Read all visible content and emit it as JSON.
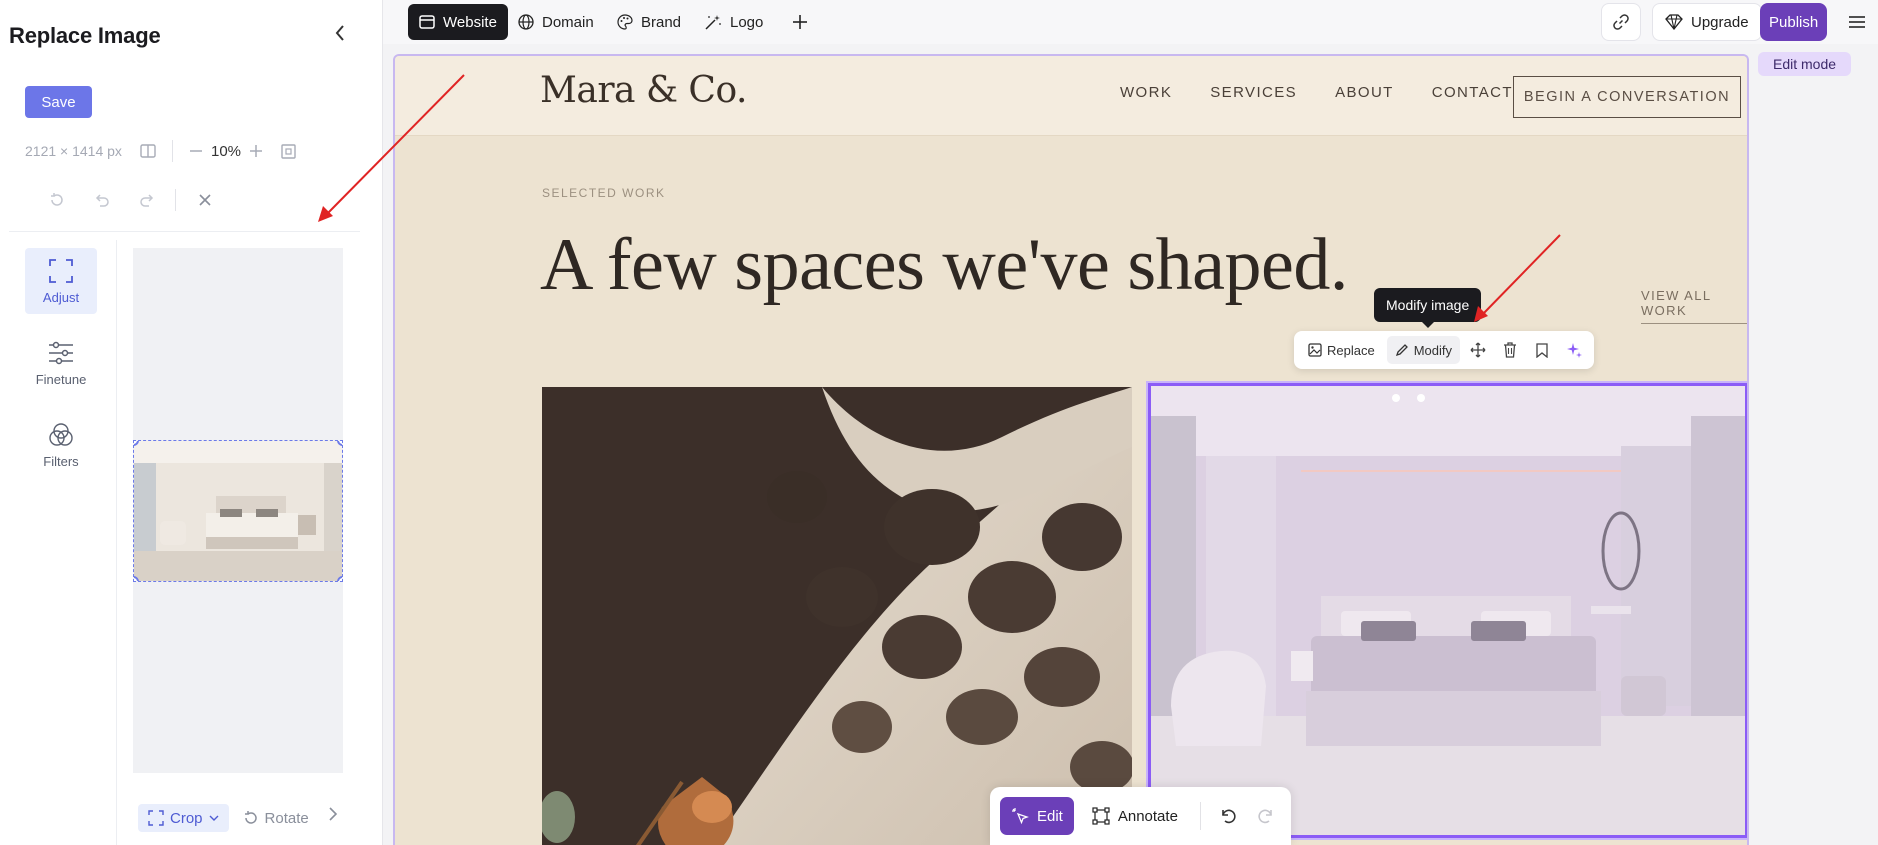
{
  "panel": {
    "title": "Replace Image",
    "save_label": "Save",
    "dimensions": "2121 × 1414 px",
    "zoom": "10%",
    "tools": [
      {
        "label": "Adjust"
      },
      {
        "label": "Finetune"
      },
      {
        "label": "Filters"
      }
    ],
    "crop_label": "Crop",
    "rotate_label": "Rotate"
  },
  "topbar": {
    "tabs": [
      "Website",
      "Domain",
      "Brand",
      "Logo"
    ],
    "upgrade_label": "Upgrade",
    "publish_label": "Publish"
  },
  "edit_mode_label": "Edit mode",
  "site": {
    "logo": "Mara & Co.",
    "nav": [
      "WORK",
      "SERVICES",
      "ABOUT",
      "CONTACT"
    ],
    "cta": "BEGIN A CONVERSATION",
    "eyebrow": "SELECTED WORK",
    "headline": "A few spaces we've shaped.",
    "view_all": "VIEW ALL WORK"
  },
  "image_toolbar": {
    "replace_label": "Replace",
    "modify_label": "Modify",
    "tooltip": "Modify image"
  },
  "bottom_bar": {
    "edit_label": "Edit",
    "annotate_label": "Annotate"
  },
  "colors": {
    "accent": "#6b3fb8",
    "save_button": "#6c76e8",
    "selection": "#8b5cf6",
    "site_bg": "#ede3d1"
  }
}
